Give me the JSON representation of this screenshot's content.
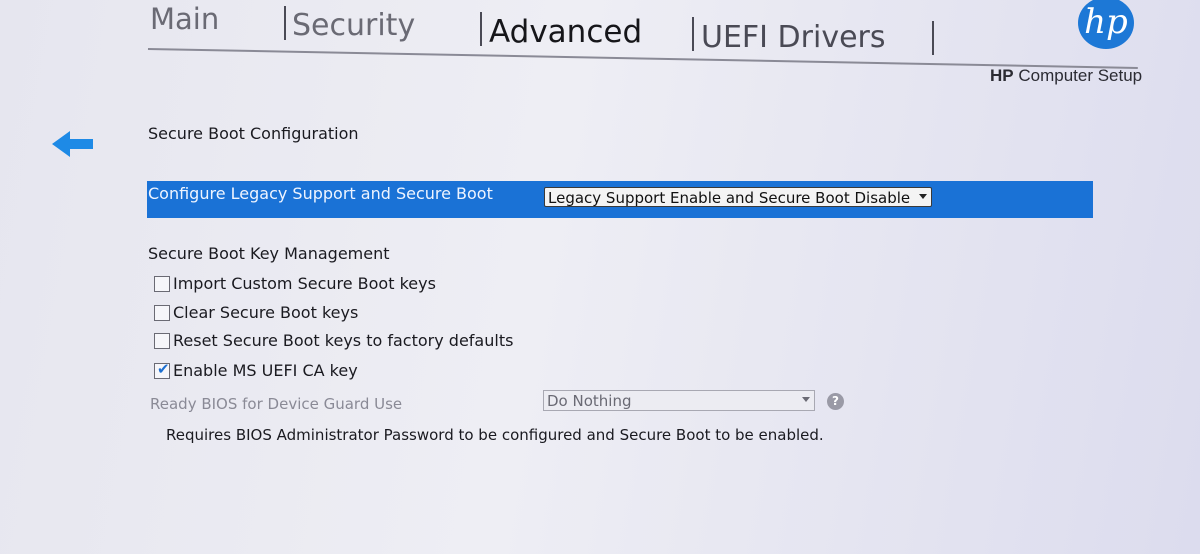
{
  "tabs": [
    {
      "label": "Main"
    },
    {
      "label": "Security"
    },
    {
      "label": "Advanced"
    },
    {
      "label": "UEFI Drivers"
    }
  ],
  "logo": {
    "text": "hp"
  },
  "brand": {
    "bold": "HP",
    "rest": " Computer Setup"
  },
  "back": {
    "icon": "back-arrow-icon"
  },
  "section": {
    "title": "Secure Boot Configuration"
  },
  "selected_row": {
    "label": "Configure Legacy Support and Secure Boot",
    "value": "Legacy Support Enable and Secure Boot Disable"
  },
  "key_management": {
    "title": "Secure Boot Key Management",
    "items": [
      {
        "label": "Import Custom Secure Boot keys",
        "checked": false
      },
      {
        "label": "Clear Secure Boot keys",
        "checked": false
      },
      {
        "label": "Reset Secure Boot keys to factory defaults",
        "checked": false
      },
      {
        "label": "Enable MS UEFI CA key",
        "checked": true
      }
    ]
  },
  "device_guard": {
    "label": "Ready BIOS for Device Guard Use",
    "value": "Do Nothing",
    "help": "?"
  },
  "note": "Requires BIOS Administrator Password to be configured and Secure Boot to be enabled.",
  "colors": {
    "accent": "#1a72d6",
    "logo": "#1d78d6"
  }
}
